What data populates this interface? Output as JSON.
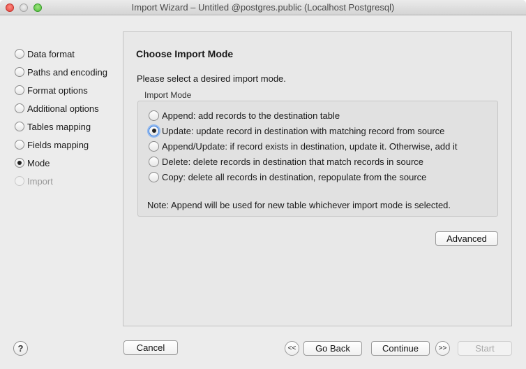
{
  "window": {
    "title": "Import Wizard – Untitled @postgres.public (Localhost Postgresql)"
  },
  "steps": [
    {
      "label": "Data format",
      "state": "unchecked"
    },
    {
      "label": "Paths and encoding",
      "state": "unchecked"
    },
    {
      "label": "Format options",
      "state": "unchecked"
    },
    {
      "label": "Additional options",
      "state": "unchecked"
    },
    {
      "label": "Tables mapping",
      "state": "unchecked"
    },
    {
      "label": "Fields mapping",
      "state": "unchecked"
    },
    {
      "label": "Mode",
      "state": "current"
    },
    {
      "label": "Import",
      "state": "disabled"
    }
  ],
  "main": {
    "heading": "Choose Import Mode",
    "prompt": "Please select a desired import mode.",
    "group_label": "Import Mode",
    "options": [
      {
        "label": "Append: add records to the destination table",
        "selected": false
      },
      {
        "label": "Update: update record in destination with matching record from source",
        "selected": true
      },
      {
        "label": "Append/Update: if record exists in destination, update it. Otherwise, add it",
        "selected": false
      },
      {
        "label": "Delete: delete records in destination that match records in source",
        "selected": false
      },
      {
        "label": "Copy: delete all records in destination, repopulate from the source",
        "selected": false
      }
    ],
    "note": "Note: Append will be used for new table whichever import mode is selected.",
    "advanced_label": "Advanced"
  },
  "footer": {
    "help_label": "?",
    "cancel_label": "Cancel",
    "first_label": "<<",
    "back_label": "Go Back",
    "continue_label": "Continue",
    "last_label": ">>",
    "start_label": "Start"
  },
  "colors": {
    "focus_ring": "#8fb8f0",
    "close": "#e0443e",
    "maximize": "#4ebf3a"
  }
}
